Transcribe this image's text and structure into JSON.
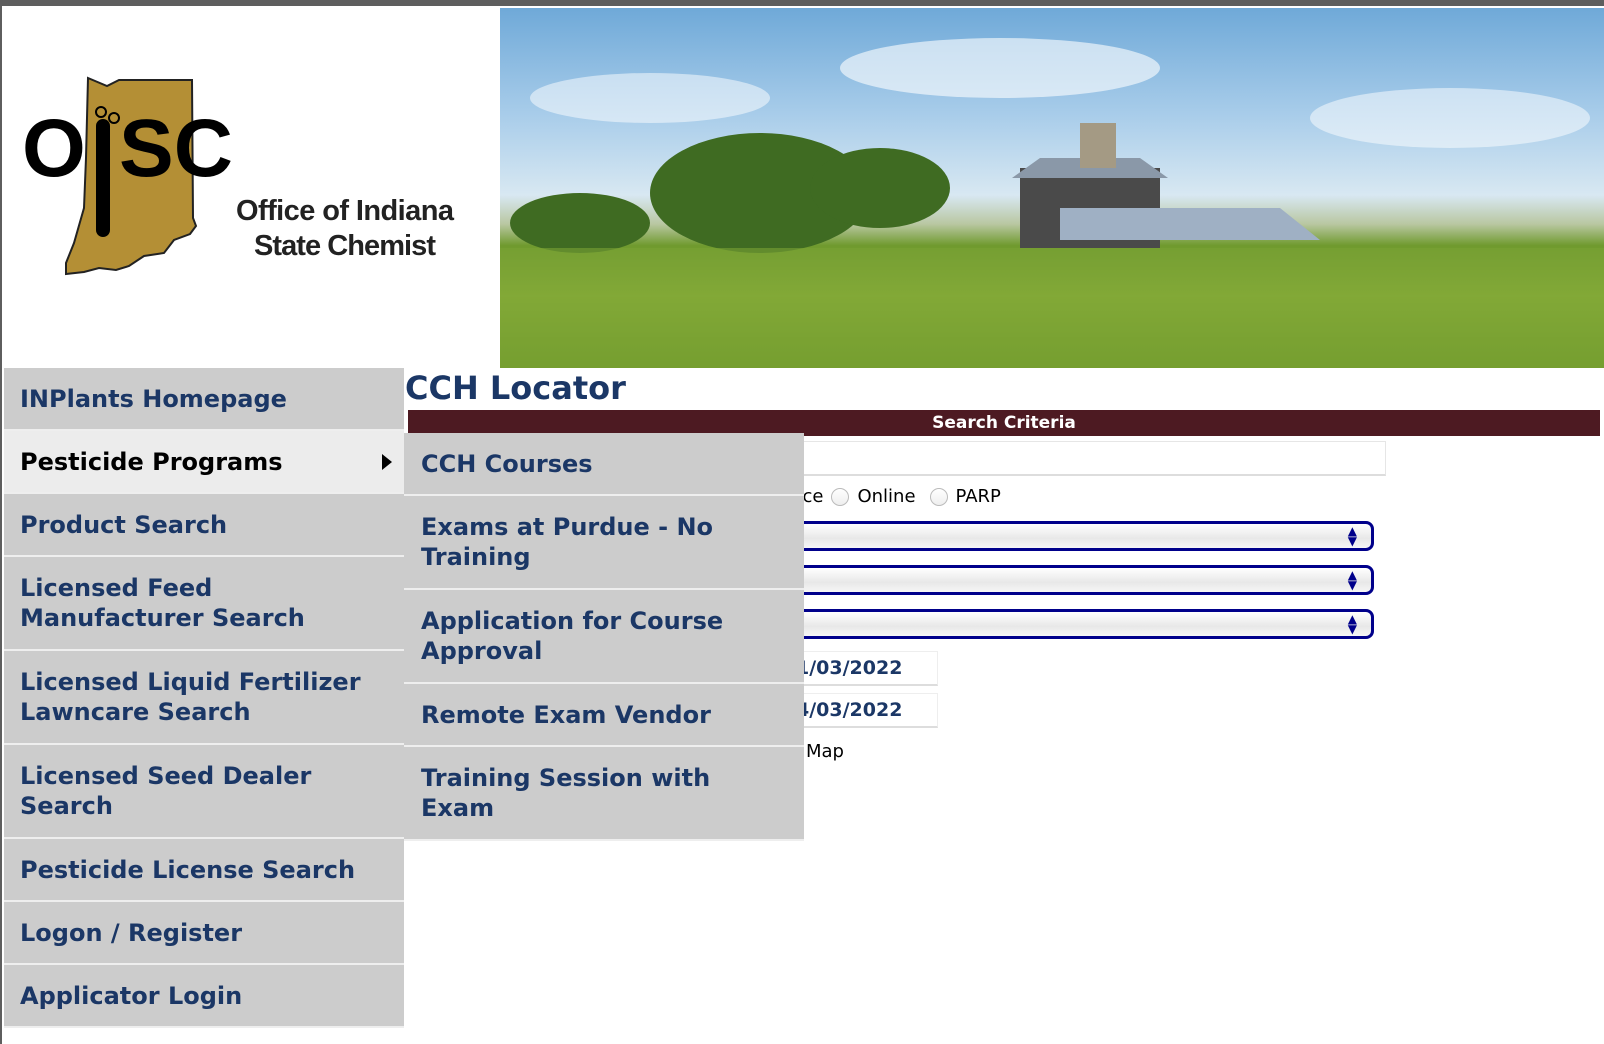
{
  "logo": {
    "text": "OISC",
    "subtitle": "Office of Indiana State Chemist",
    "gold": "#b48f35"
  },
  "page_title": "CCH Locator",
  "search_criteria": "Search Criteria",
  "radios": {
    "partial_label": "ence",
    "online": "Online",
    "parp": "PARP"
  },
  "dates": {
    "start": "1/03/2022",
    "end": "4/03/2022"
  },
  "map_label": "Map",
  "sidebar": {
    "items": [
      {
        "label": "INPlants Homepage"
      },
      {
        "label": "Pesticide Programs",
        "active": true
      },
      {
        "label": "Product Search"
      },
      {
        "label": "Licensed Feed Manufacturer Search"
      },
      {
        "label": "Licensed Liquid Fertilizer Lawncare Search"
      },
      {
        "label": "Licensed Seed Dealer Search"
      },
      {
        "label": "Pesticide License Search"
      },
      {
        "label": "Logon / Register"
      },
      {
        "label": "Applicator Login"
      }
    ]
  },
  "submenu": {
    "items": [
      {
        "label": "CCH Courses"
      },
      {
        "label": "Exams at Purdue - No Training"
      },
      {
        "label": "Application for Course Approval"
      },
      {
        "label": "Remote Exam Vendor"
      },
      {
        "label": "Training Session with Exam"
      }
    ]
  },
  "colors": {
    "nav_text": "#1b3766",
    "criteria_bar": "#4d1a22",
    "select_border": "#00008b"
  }
}
